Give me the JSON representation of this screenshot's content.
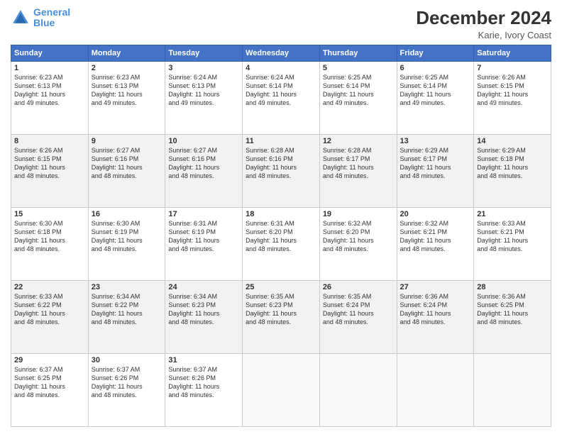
{
  "header": {
    "logo_line1": "General",
    "logo_line2": "Blue",
    "month": "December 2024",
    "location": "Karie, Ivory Coast"
  },
  "weekdays": [
    "Sunday",
    "Monday",
    "Tuesday",
    "Wednesday",
    "Thursday",
    "Friday",
    "Saturday"
  ],
  "weeks": [
    [
      {
        "day": "1",
        "rise": "6:23 AM",
        "set": "6:13 PM",
        "hours": "11",
        "mins": "49"
      },
      {
        "day": "2",
        "rise": "6:23 AM",
        "set": "6:13 PM",
        "hours": "11",
        "mins": "49"
      },
      {
        "day": "3",
        "rise": "6:24 AM",
        "set": "6:13 PM",
        "hours": "11",
        "mins": "49"
      },
      {
        "day": "4",
        "rise": "6:24 AM",
        "set": "6:14 PM",
        "hours": "11",
        "mins": "49"
      },
      {
        "day": "5",
        "rise": "6:25 AM",
        "set": "6:14 PM",
        "hours": "11",
        "mins": "49"
      },
      {
        "day": "6",
        "rise": "6:25 AM",
        "set": "6:14 PM",
        "hours": "11",
        "mins": "49"
      },
      {
        "day": "7",
        "rise": "6:26 AM",
        "set": "6:15 PM",
        "hours": "11",
        "mins": "49"
      }
    ],
    [
      {
        "day": "8",
        "rise": "6:26 AM",
        "set": "6:15 PM",
        "hours": "11",
        "mins": "48"
      },
      {
        "day": "9",
        "rise": "6:27 AM",
        "set": "6:16 PM",
        "hours": "11",
        "mins": "48"
      },
      {
        "day": "10",
        "rise": "6:27 AM",
        "set": "6:16 PM",
        "hours": "11",
        "mins": "48"
      },
      {
        "day": "11",
        "rise": "6:28 AM",
        "set": "6:16 PM",
        "hours": "11",
        "mins": "48"
      },
      {
        "day": "12",
        "rise": "6:28 AM",
        "set": "6:17 PM",
        "hours": "11",
        "mins": "48"
      },
      {
        "day": "13",
        "rise": "6:29 AM",
        "set": "6:17 PM",
        "hours": "11",
        "mins": "48"
      },
      {
        "day": "14",
        "rise": "6:29 AM",
        "set": "6:18 PM",
        "hours": "11",
        "mins": "48"
      }
    ],
    [
      {
        "day": "15",
        "rise": "6:30 AM",
        "set": "6:18 PM",
        "hours": "11",
        "mins": "48"
      },
      {
        "day": "16",
        "rise": "6:30 AM",
        "set": "6:19 PM",
        "hours": "11",
        "mins": "48"
      },
      {
        "day": "17",
        "rise": "6:31 AM",
        "set": "6:19 PM",
        "hours": "11",
        "mins": "48"
      },
      {
        "day": "18",
        "rise": "6:31 AM",
        "set": "6:20 PM",
        "hours": "11",
        "mins": "48"
      },
      {
        "day": "19",
        "rise": "6:32 AM",
        "set": "6:20 PM",
        "hours": "11",
        "mins": "48"
      },
      {
        "day": "20",
        "rise": "6:32 AM",
        "set": "6:21 PM",
        "hours": "11",
        "mins": "48"
      },
      {
        "day": "21",
        "rise": "6:33 AM",
        "set": "6:21 PM",
        "hours": "11",
        "mins": "48"
      }
    ],
    [
      {
        "day": "22",
        "rise": "6:33 AM",
        "set": "6:22 PM",
        "hours": "11",
        "mins": "48"
      },
      {
        "day": "23",
        "rise": "6:34 AM",
        "set": "6:22 PM",
        "hours": "11",
        "mins": "48"
      },
      {
        "day": "24",
        "rise": "6:34 AM",
        "set": "6:23 PM",
        "hours": "11",
        "mins": "48"
      },
      {
        "day": "25",
        "rise": "6:35 AM",
        "set": "6:23 PM",
        "hours": "11",
        "mins": "48"
      },
      {
        "day": "26",
        "rise": "6:35 AM",
        "set": "6:24 PM",
        "hours": "11",
        "mins": "48"
      },
      {
        "day": "27",
        "rise": "6:36 AM",
        "set": "6:24 PM",
        "hours": "11",
        "mins": "48"
      },
      {
        "day": "28",
        "rise": "6:36 AM",
        "set": "6:25 PM",
        "hours": "11",
        "mins": "48"
      }
    ],
    [
      {
        "day": "29",
        "rise": "6:37 AM",
        "set": "6:25 PM",
        "hours": "11",
        "mins": "48"
      },
      {
        "day": "30",
        "rise": "6:37 AM",
        "set": "6:26 PM",
        "hours": "11",
        "mins": "48"
      },
      {
        "day": "31",
        "rise": "6:37 AM",
        "set": "6:26 PM",
        "hours": "11",
        "mins": "48"
      },
      null,
      null,
      null,
      null
    ]
  ]
}
